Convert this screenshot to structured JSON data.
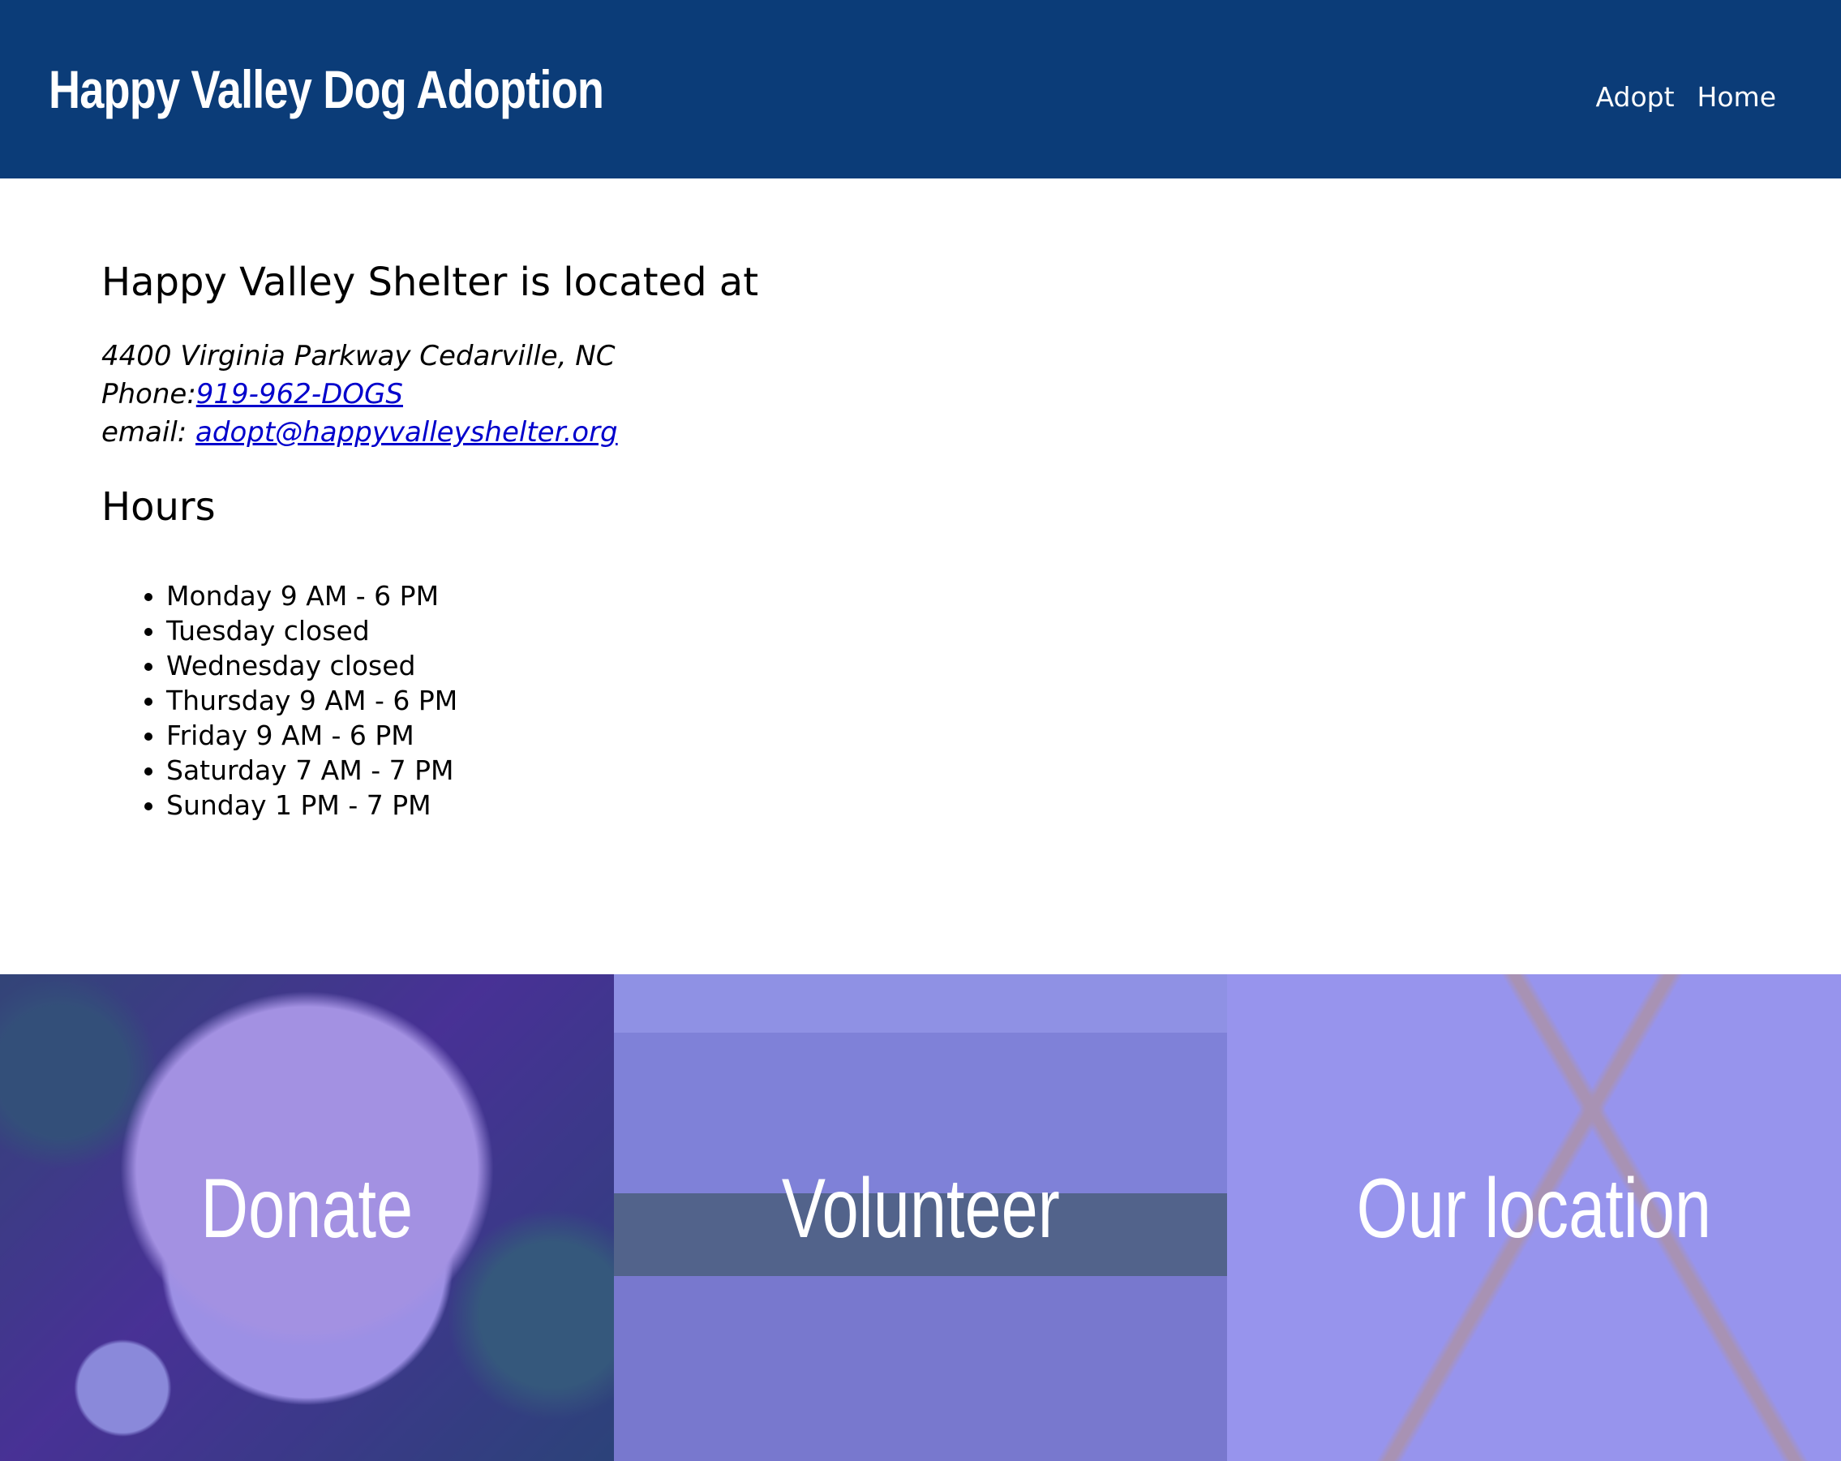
{
  "header": {
    "brand": "Happy Valley Dog Adoption",
    "nav": [
      "Adopt",
      "Home"
    ]
  },
  "location": {
    "heading": "Happy Valley Shelter is located at",
    "address": "4400 Virginia Parkway Cedarville, NC",
    "phone_label": "Phone:",
    "phone": "919-962-DOGS",
    "email_label": "email: ",
    "email": "adopt@happyvalleyshelter.org"
  },
  "hours": {
    "heading": "Hours",
    "items": [
      "Monday 9 AM - 6 PM",
      "Tuesday closed",
      "Wednesday closed",
      "Thursday 9 AM - 6 PM",
      "Friday 9 AM - 6 PM",
      "Saturday 7 AM - 7 PM",
      "Sunday 1 PM - 7 PM"
    ]
  },
  "tiles": [
    {
      "label": "Donate"
    },
    {
      "label": "Volunteer"
    },
    {
      "label": "Our location"
    }
  ]
}
